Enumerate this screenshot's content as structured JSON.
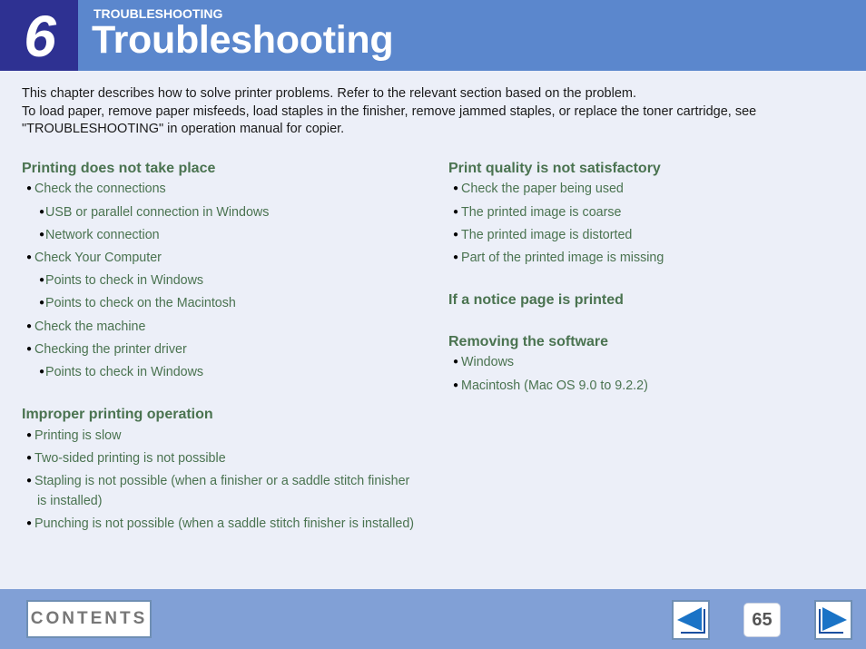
{
  "header": {
    "chapter_number": "6",
    "section_label": "TROUBLESHOOTING",
    "title": "Troubleshooting"
  },
  "intro": {
    "line1": "This chapter describes how to solve printer problems. Refer to the relevant section based on the problem.",
    "line2": "To load paper, remove paper misfeeds, load staples in the finisher, remove jammed staples, or replace the toner cartridge, see \"TROUBLESHOOTING\" in operation manual for copier."
  },
  "left_column": {
    "printing_does_not_take_place": {
      "title": "Printing does not take place",
      "items": [
        {
          "label": "Check the connections",
          "level": 1
        },
        {
          "label": "USB or parallel connection in Windows",
          "level": 2
        },
        {
          "label": "Network connection",
          "level": 2
        },
        {
          "label": "Check Your Computer",
          "level": 1
        },
        {
          "label": "Points to check in Windows",
          "level": 2
        },
        {
          "label": "Points to check on the Macintosh",
          "level": 2
        },
        {
          "label": "Check the machine",
          "level": 1
        },
        {
          "label": "Checking the printer driver",
          "level": 1
        },
        {
          "label": "Points to check in Windows",
          "level": 2
        }
      ]
    },
    "improper_printing_operation": {
      "title": "Improper printing operation",
      "items": [
        {
          "label": "Printing is slow"
        },
        {
          "label": "Two-sided printing is not possible"
        },
        {
          "label": "Stapling is not possible (when a finisher or a saddle stitch finisher"
        },
        {
          "label": "Punching is not possible (when a saddle stitch finisher is installed)"
        }
      ],
      "stapling_continuation": "is installed)"
    }
  },
  "right_column": {
    "print_quality": {
      "title": "Print quality is not satisfactory",
      "items": [
        {
          "label": "Check the paper being used"
        },
        {
          "label": "The printed image is coarse"
        },
        {
          "label": "The printed image is distorted"
        },
        {
          "label": "Part of the printed image is missing"
        }
      ]
    },
    "notice_page": {
      "title": "If a notice page is printed"
    },
    "removing_software": {
      "title": "Removing the software",
      "items": [
        {
          "label": "Windows"
        },
        {
          "label": "Macintosh (Mac OS 9.0 to 9.2.2)"
        }
      ]
    }
  },
  "footer": {
    "contents_label": "CONTENTS",
    "page_number": "65",
    "prev_icon": "left-arrow-icon",
    "next_icon": "right-arrow-icon"
  },
  "colors": {
    "header_bg": "#5b87cd",
    "chapter_box": "#2e3192",
    "heading_green": "#4a7350",
    "footer_bg": "#81a0d6",
    "arrow_blue": "#1a73c6"
  }
}
